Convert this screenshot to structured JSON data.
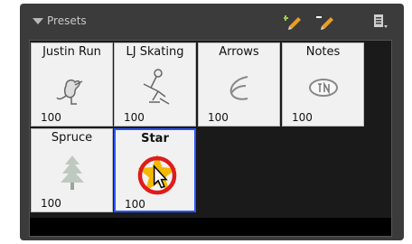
{
  "panel": {
    "title": "Presets"
  },
  "presets": [
    {
      "name": "Justin Run",
      "value": "100"
    },
    {
      "name": "LJ Skating",
      "value": "100"
    },
    {
      "name": "Arrows",
      "value": "100"
    },
    {
      "name": "Notes",
      "value": "100"
    },
    {
      "name": "Spruce",
      "value": "100"
    },
    {
      "name": "Star",
      "value": "100"
    }
  ],
  "icons": {
    "toggle": "triangle-down",
    "new_preset": "new-preset-icon",
    "edit_preset": "edit-preset-icon",
    "menu": "panel-menu-icon"
  },
  "colors": {
    "panel_bg": "#3b3b3b",
    "tile_bg": "#f1f1f1",
    "selected_border": "#2b55ff",
    "highlight_circle": "#e01b1b",
    "star_fill": "#f5b800"
  }
}
